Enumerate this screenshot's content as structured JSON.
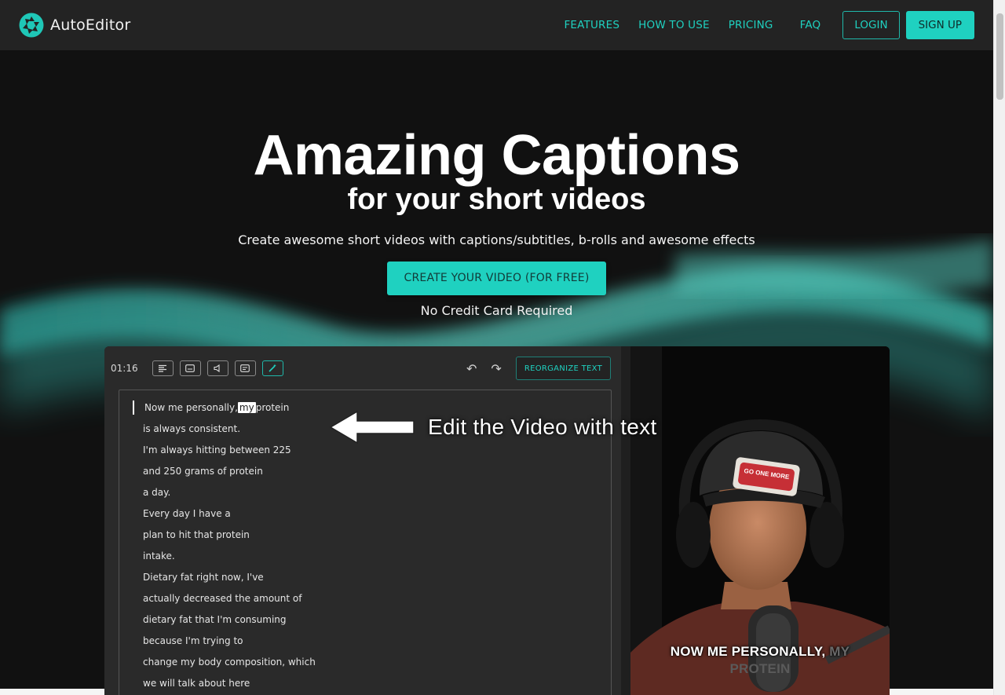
{
  "nav": {
    "brand": "AutoEditor",
    "links": [
      "FEATURES",
      "HOW TO USE",
      "PRICING",
      "FAQ"
    ],
    "login": "LOGIN",
    "signup": "SIGN UP"
  },
  "hero": {
    "title": "Amazing Captions",
    "subtitle": "for your short videos",
    "description": "Create awesome short videos with captions/subtitles, b-rolls and awesome effects",
    "cta": "CREATE YOUR VIDEO (FOR FREE)",
    "note": "No Credit Card Required"
  },
  "editor": {
    "time": "01:16",
    "reorganize": "REORGANIZE TEXT",
    "first_line_before": "Now me personally,",
    "first_line_highlight": "my",
    "first_line_after": "protein",
    "lines": [
      "is always consistent.",
      "I'm always hitting between 225",
      "and 250 grams of protein",
      "a day.",
      "Every day I have a",
      "plan to hit that protein",
      "intake.",
      "Dietary fat right now, I've",
      "actually decreased the amount of",
      "dietary fat that I'm consuming",
      "because I'm trying to",
      "change my body composition, which",
      "we will talk about here"
    ]
  },
  "annotation": "Edit the Video with text",
  "video": {
    "caption_main": "NOW ME PERSONALLY,",
    "caption_dim": "MY",
    "caption_second": "PROTEIN",
    "hat_text": "GO ONE MORE"
  },
  "colors": {
    "accent": "#1fd1c0",
    "navbar": "#232323",
    "background": "#111111"
  }
}
